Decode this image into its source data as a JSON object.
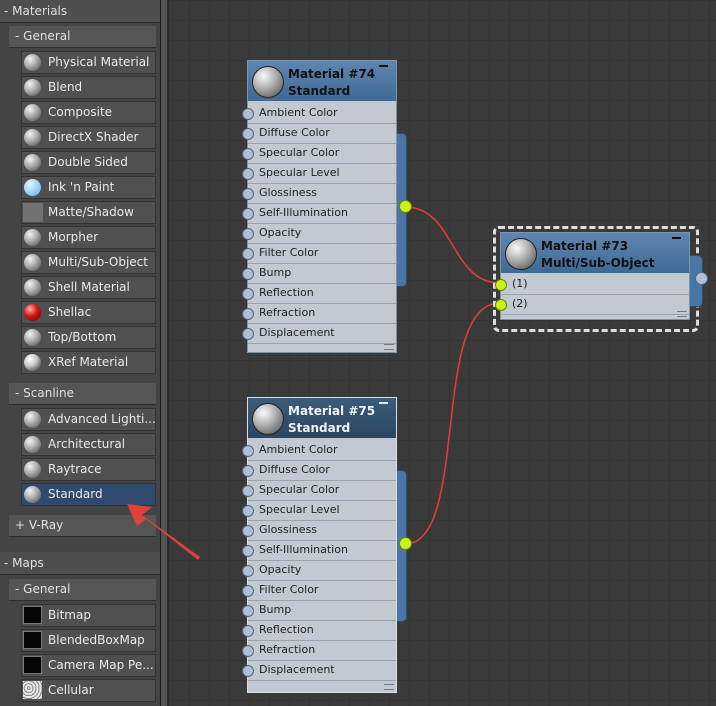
{
  "browser": {
    "materials_header": "- Materials",
    "general_header": "- General",
    "general_items": [
      {
        "label": "Physical Material",
        "swatch": "sphere"
      },
      {
        "label": "Blend",
        "swatch": "sphere"
      },
      {
        "label": "Composite",
        "swatch": "sphere"
      },
      {
        "label": "DirectX Shader",
        "swatch": "sphere"
      },
      {
        "label": "Double Sided",
        "swatch": "sphere"
      },
      {
        "label": "Ink 'n Paint",
        "swatch": "ink"
      },
      {
        "label": "Matte/Shadow",
        "swatch": "matte"
      },
      {
        "label": "Morpher",
        "swatch": "sphere"
      },
      {
        "label": "Multi/Sub-Object",
        "swatch": "sphere"
      },
      {
        "label": "Shell Material",
        "swatch": "sphere"
      },
      {
        "label": "Shellac",
        "swatch": "shellac"
      },
      {
        "label": "Top/Bottom",
        "swatch": "sphere"
      },
      {
        "label": "XRef Material",
        "swatch": "xref"
      }
    ],
    "scanline_header": "- Scanline",
    "scanline_items": [
      {
        "label": "Advanced Lighti...",
        "swatch": "sphere"
      },
      {
        "label": "Architectural",
        "swatch": "sphere"
      },
      {
        "label": "Raytrace",
        "swatch": "sphere"
      },
      {
        "label": "Standard",
        "swatch": "sphere",
        "selected": true
      }
    ],
    "vray_header": "+ V-Ray",
    "maps_header": "- Maps",
    "maps_general_header": "- General",
    "maps_items": [
      {
        "label": "Bitmap",
        "swatch": "black"
      },
      {
        "label": "BlendedBoxMap",
        "swatch": "black"
      },
      {
        "label": "Camera Map Pe...",
        "swatch": "black"
      },
      {
        "label": "Cellular",
        "swatch": "noise"
      }
    ]
  },
  "nodes": {
    "mat74": {
      "name": "Material #74",
      "type": "Standard"
    },
    "mat75": {
      "name": "Material #75",
      "type": "Standard"
    },
    "mat73": {
      "name": "Material #73",
      "type": "Multi/Sub-Object",
      "slots": [
        "(1)",
        "(2)"
      ]
    }
  },
  "standard_slots": [
    "Ambient Color",
    "Diffuse Color",
    "Specular Color",
    "Specular Level",
    "Glossiness",
    "Self-Illumination",
    "Opacity",
    "Filter Color",
    "Bump",
    "Reflection",
    "Refraction",
    "Displacement"
  ],
  "colors": {
    "selected_item": "#2e4a6e",
    "wire": "#e03a3a",
    "arrow": "#e0403a",
    "connected_port": "#c8f21a"
  }
}
